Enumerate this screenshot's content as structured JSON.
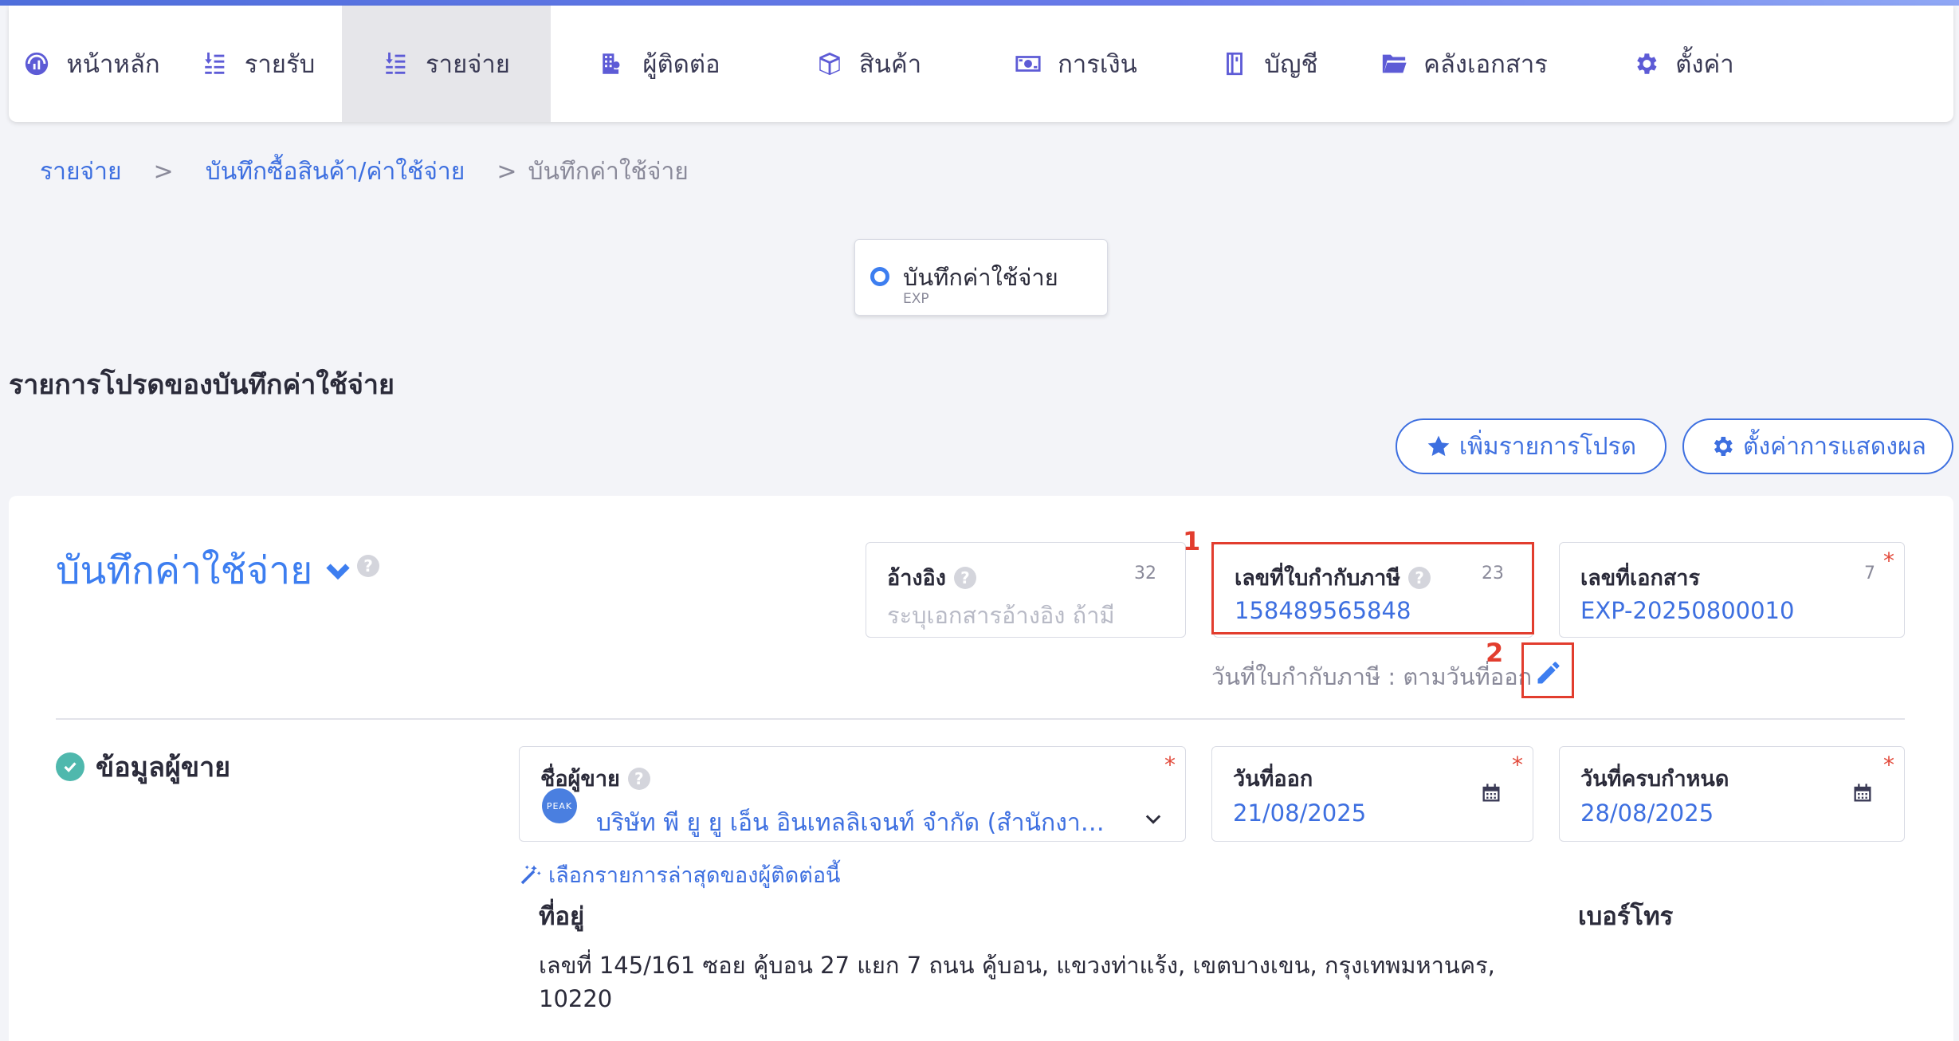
{
  "nav": {
    "items": [
      {
        "label": "หน้าหลัก",
        "icon": "dashboard-icon"
      },
      {
        "label": "รายรับ",
        "icon": "income-icon"
      },
      {
        "label": "รายจ่าย",
        "icon": "expense-icon",
        "active": true
      },
      {
        "label": "ผู้ติดต่อ",
        "icon": "contacts-icon"
      },
      {
        "label": "สินค้า",
        "icon": "product-box-icon"
      },
      {
        "label": "การเงิน",
        "icon": "money-icon"
      },
      {
        "label": "บัญชี",
        "icon": "ledger-book-icon"
      },
      {
        "label": "คลังเอกสาร",
        "icon": "folder-icon"
      },
      {
        "label": "ตั้งค่า",
        "icon": "gear-icon"
      }
    ]
  },
  "breadcrumb": {
    "items": [
      "รายจ่าย",
      "บันทึกซื้อสินค้า/ค่าใช้จ่าย"
    ],
    "current": "บันทึกค่าใช้จ่าย",
    "separator": ">"
  },
  "doc_type": {
    "label": "บันทึกค่าใช้จ่าย",
    "code": "EXP"
  },
  "favorites": {
    "title": "รายการโปรดของบันทึกค่าใช้จ่าย",
    "add_button": "เพิ่มรายการโปรด",
    "display_settings_button": "ตั้งค่าการแสดงผล"
  },
  "form": {
    "title": "บันทึกค่าใช้จ่าย",
    "reference": {
      "label": "อ้างอิง",
      "count": "32",
      "placeholder": "ระบุเอกสารอ้างอิง ถ้ามี"
    },
    "tax_invoice_no": {
      "label": "เลขที่ใบกำกับภาษี",
      "count": "23",
      "value": "158489565848"
    },
    "document_no": {
      "label": "เลขที่เอกสาร",
      "count": "7",
      "value": "EXP-20250800010",
      "required_mark": "*"
    },
    "tax_invoice_date_note": "วันที่ใบกำกับภาษี : ตามวันที่ออก",
    "annotations": [
      "1",
      "2"
    ]
  },
  "vendor": {
    "heading": "ข้อมูลผู้ขาย",
    "name_label": "ชื่อผู้ขาย",
    "name_value": "บริษัท พี ยู ยู เอ็น อินเทลลิเจนท์ จำกัด (สำนักงานให...",
    "logo_text": "PEAK",
    "issue_date_label": "วันที่ออก",
    "issue_date_value": "21/08/2025",
    "due_date_label": "วันที่ครบกำหนด",
    "due_date_value": "28/08/2025",
    "required_mark": "*",
    "latest_link": "เลือกรายการล่าสุดของผู้ติดต่อนี้",
    "address_label": "ที่อยู่",
    "phone_label": "เบอร์โทร",
    "address_line1": "เลขที่ 145/161 ซอย คู้บอน 27 แยก 7 ถนน คู้บอน, แขวงท่าแร้ง, เขตบางเขน, กรุงเทพมหานคร,",
    "address_line2": "10220"
  },
  "colors": {
    "accent": "#3d6fe0",
    "highlight": "#e23d2e",
    "success": "#4fb8ad"
  }
}
